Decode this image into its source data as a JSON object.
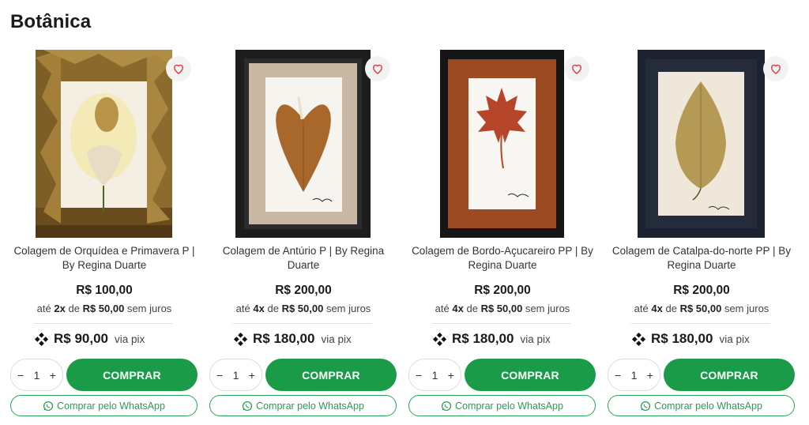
{
  "section": {
    "title": "Botânica"
  },
  "colors": {
    "accent": "#1a9b47",
    "whatsapp": "#2aa45a"
  },
  "products": [
    {
      "name": "Colagem de Orquídea e Primavera P | By Regina Duarte",
      "price": "R$ 100,00",
      "installment": {
        "prefix": "até",
        "count": "2x",
        "middle": "de",
        "value": "R$ 50,00",
        "suffix": "sem juros"
      },
      "pix_price": "R$ 90,00",
      "pix_label": "via pix",
      "qty": {
        "minus": "−",
        "value": "1",
        "plus": "+"
      },
      "buy_label": "COMPRAR",
      "whatsapp_label": "Comprar pelo WhatsApp"
    },
    {
      "name": "Colagem de Antúrio P | By Regina Duarte",
      "price": "R$ 200,00",
      "installment": {
        "prefix": "até",
        "count": "4x",
        "middle": "de",
        "value": "R$ 50,00",
        "suffix": "sem juros"
      },
      "pix_price": "R$ 180,00",
      "pix_label": "via pix",
      "qty": {
        "minus": "−",
        "value": "1",
        "plus": "+"
      },
      "buy_label": "COMPRAR",
      "whatsapp_label": "Comprar pelo WhatsApp"
    },
    {
      "name": "Colagem de Bordo-Açucareiro PP | By Regina Duarte",
      "price": "R$ 200,00",
      "installment": {
        "prefix": "até",
        "count": "4x",
        "middle": "de",
        "value": "R$ 50,00",
        "suffix": "sem juros"
      },
      "pix_price": "R$ 180,00",
      "pix_label": "via pix",
      "qty": {
        "minus": "−",
        "value": "1",
        "plus": "+"
      },
      "buy_label": "COMPRAR",
      "whatsapp_label": "Comprar pelo WhatsApp"
    },
    {
      "name": "Colagem de Catalpa-do-norte PP | By Regina Duarte",
      "price": "R$ 200,00",
      "installment": {
        "prefix": "até",
        "count": "4x",
        "middle": "de",
        "value": "R$ 50,00",
        "suffix": "sem juros"
      },
      "pix_price": "R$ 180,00",
      "pix_label": "via pix",
      "qty": {
        "minus": "−",
        "value": "1",
        "plus": "+"
      },
      "buy_label": "COMPRAR",
      "whatsapp_label": "Comprar pelo WhatsApp"
    }
  ]
}
